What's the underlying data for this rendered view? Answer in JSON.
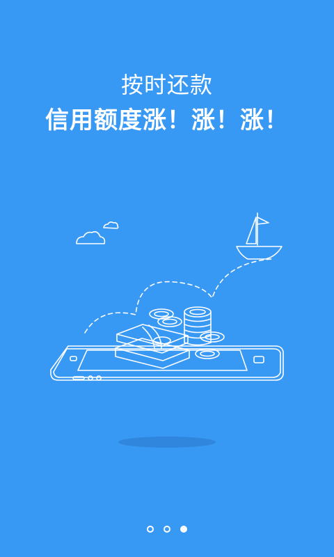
{
  "splash": {
    "subtitle": "按时还款",
    "headline": "信用额度涨！涨！涨！"
  },
  "pager": {
    "total": 3,
    "active_index": 2
  },
  "colors": {
    "background": "#3899f5",
    "line_art": "#ffffff",
    "shadow": "#2f86dc"
  },
  "icons": [
    "cloud-icon",
    "sailboat-icon",
    "phone-icon",
    "money-bundle-icon",
    "coin-icon"
  ]
}
